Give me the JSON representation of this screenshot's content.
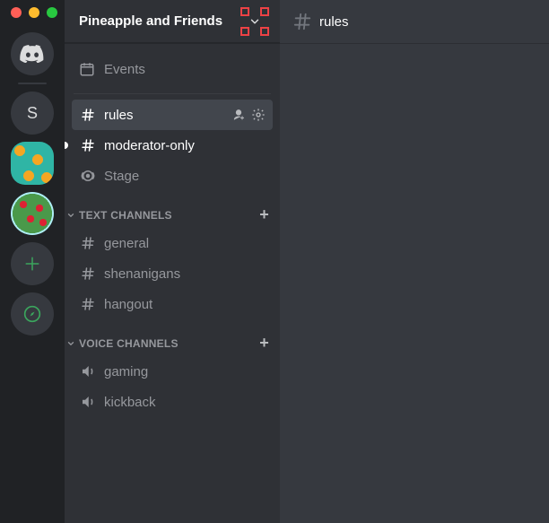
{
  "server": {
    "name": "Pineapple and Friends"
  },
  "server_rail": {
    "initial": "S"
  },
  "events_label": "Events",
  "top_channels": [
    {
      "name": "rules",
      "type": "text",
      "active": true
    },
    {
      "name": "moderator-only",
      "type": "text",
      "unread": true
    },
    {
      "name": "Stage",
      "type": "stage"
    }
  ],
  "categories": [
    {
      "label": "TEXT CHANNELS",
      "channels": [
        {
          "name": "general",
          "type": "text"
        },
        {
          "name": "shenanigans",
          "type": "text"
        },
        {
          "name": "hangout",
          "type": "text"
        }
      ]
    },
    {
      "label": "VOICE CHANNELS",
      "channels": [
        {
          "name": "gaming",
          "type": "voice"
        },
        {
          "name": "kickback",
          "type": "voice"
        }
      ]
    }
  ],
  "main_header": {
    "channel": "rules"
  }
}
